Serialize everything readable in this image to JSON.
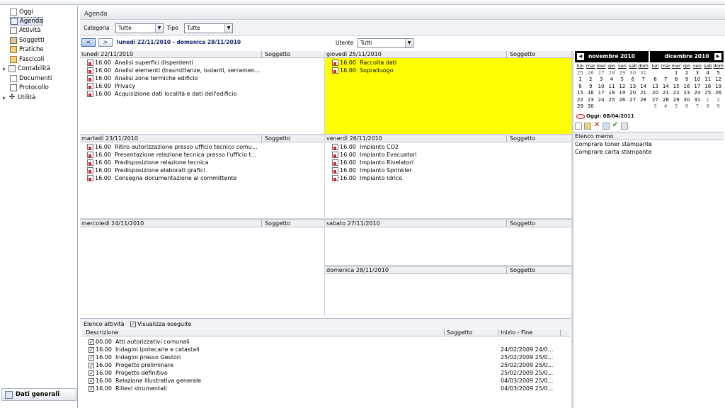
{
  "sidebar": {
    "items": [
      {
        "label": "Oggi",
        "icon": "document-icon"
      },
      {
        "label": "Agenda",
        "icon": "calendar-icon"
      },
      {
        "label": "Attività",
        "icon": "checklist-icon"
      },
      {
        "label": "Soggetti",
        "icon": "people-icon"
      },
      {
        "label": "Pratiche",
        "icon": "folder-icon"
      },
      {
        "label": "Fascicoli",
        "icon": "folder-icon"
      },
      {
        "label": "Contabilità",
        "icon": "ledger-icon"
      },
      {
        "label": "Documenti",
        "icon": "documents-icon"
      },
      {
        "label": "Protocollo",
        "icon": "mail-icon"
      },
      {
        "label": "Utilità",
        "icon": "tools-icon"
      }
    ],
    "bottom_button": "Dati generali"
  },
  "header": {
    "title": "Agenda"
  },
  "filters": {
    "categoria_label": "Categoria",
    "categoria_value": "Tutte",
    "tipo_label": "Tipo",
    "tipo_value": "Tutte",
    "utente_label": "Utente",
    "utente_value": "Tutti"
  },
  "week": {
    "prev": "<",
    "next": ">",
    "range": "lunedì 22/11/2010 - domenica 28/11/2010",
    "subject_col": "Soggetto",
    "days": [
      {
        "label": "lunedì 22/11/2010",
        "events": [
          {
            "time": "16.00",
            "title": "Analisi superfici disperdenti"
          },
          {
            "time": "16.00",
            "title": "Analisi elementi (trasmittanze, isolanti, serramen..."
          },
          {
            "time": "16.00",
            "title": "Analisi zone termiche edificio"
          },
          {
            "time": "16.00",
            "title": "Privacy"
          },
          {
            "time": "16.00",
            "title": "Acquisizione dati località e dati dell'edificio"
          }
        ]
      },
      {
        "label": "giovedì 25/11/2010",
        "events": [
          {
            "time": "16.00",
            "title": "Raccolta dati"
          },
          {
            "time": "16.00",
            "title": "Sopralluogo"
          }
        ]
      },
      {
        "label": "martedì 23/11/2010",
        "events": [
          {
            "time": "16.00",
            "title": "Ritiro autorizzazione presso ufficio tecnico comu..."
          },
          {
            "time": "16.00",
            "title": "Presentazione relazione tecnica presso l'ufficio t..."
          },
          {
            "time": "16.00",
            "title": "Predisposizione relazione tecnica"
          },
          {
            "time": "16.00",
            "title": "Predisposizione elaborati grafici"
          },
          {
            "time": "16.00",
            "title": "Consegna documentazione al committente"
          }
        ]
      },
      {
        "label": "venerdì 26/11/2010",
        "events": [
          {
            "time": "16.00",
            "title": "Impianto CO2"
          },
          {
            "time": "16.00",
            "title": "Impianto Evacuatori"
          },
          {
            "time": "16.00",
            "title": "Impianto Rivelatori"
          },
          {
            "time": "16.00",
            "title": "Impianto Sprinkler"
          },
          {
            "time": "16.00",
            "title": "Impianto Idrico"
          }
        ]
      },
      {
        "label": "mercoledì 24/11/2010",
        "events": []
      },
      {
        "label": "sabato 27/11/2010",
        "events": []
      },
      {
        "label": "domenica 28/11/2010",
        "events": []
      }
    ]
  },
  "activities": {
    "title": "Elenco attività",
    "show_done_label": "Visualizza eseguite",
    "columns": [
      "Descrizione",
      "Soggetto",
      "Inizio - Fine"
    ],
    "rows": [
      {
        "time": "00.00",
        "desc": "Atti autorizzativi comunali",
        "dates": ""
      },
      {
        "time": "16.00",
        "desc": "Indagini ipotecarie e catastali",
        "dates": "24/02/2009  24/0..."
      },
      {
        "time": "16.00",
        "desc": "Indagini presso Gestori",
        "dates": "25/02/2009  25/0..."
      },
      {
        "time": "16.00",
        "desc": "Progetto preliminare",
        "dates": "25/02/2009  25/0..."
      },
      {
        "time": "16.00",
        "desc": "Progetto definitivo",
        "dates": "25/02/2009  25/0..."
      },
      {
        "time": "16.00",
        "desc": "Relazione illustrativa generale",
        "dates": "04/03/2009  25/0..."
      },
      {
        "time": "16.00",
        "desc": "Rilievi strumentali",
        "dates": "04/03/2009  25/0..."
      }
    ]
  },
  "calendar": {
    "weekdays": [
      "lun",
      "mar",
      "mer",
      "gio",
      "ven",
      "sab",
      "dom"
    ],
    "months": [
      {
        "title": "novembre 2010",
        "days": [
          [
            "25",
            "26",
            "27",
            "28",
            "29",
            "30",
            "31"
          ],
          [
            "1",
            "2",
            "3",
            "4",
            "5",
            "6",
            "7"
          ],
          [
            "8",
            "9",
            "10",
            "11",
            "12",
            "13",
            "14"
          ],
          [
            "15",
            "16",
            "17",
            "18",
            "19",
            "20",
            "21"
          ],
          [
            "22",
            "23",
            "24",
            "25",
            "26",
            "27",
            "28"
          ],
          [
            "29",
            "30",
            "",
            "",
            "",
            "",
            ""
          ]
        ]
      },
      {
        "title": "dicembre 2010",
        "days": [
          [
            "",
            "",
            "1",
            "2",
            "3",
            "4",
            "5"
          ],
          [
            "6",
            "7",
            "8",
            "9",
            "10",
            "11",
            "12"
          ],
          [
            "13",
            "14",
            "15",
            "16",
            "17",
            "18",
            "19"
          ],
          [
            "20",
            "21",
            "22",
            "23",
            "24",
            "25",
            "26"
          ],
          [
            "27",
            "28",
            "29",
            "30",
            "31",
            "1",
            "2"
          ],
          [
            "3",
            "4",
            "5",
            "6",
            "7",
            "8",
            "9"
          ]
        ]
      }
    ],
    "today_label": "Oggi: 08/04/2011"
  },
  "memo": {
    "title": "Elenco memo",
    "items": [
      "Comprare toner stampante",
      "Comprare carta stampante"
    ]
  },
  "colors": {
    "highlight": "#ffff00",
    "range_text": "#142a72"
  }
}
